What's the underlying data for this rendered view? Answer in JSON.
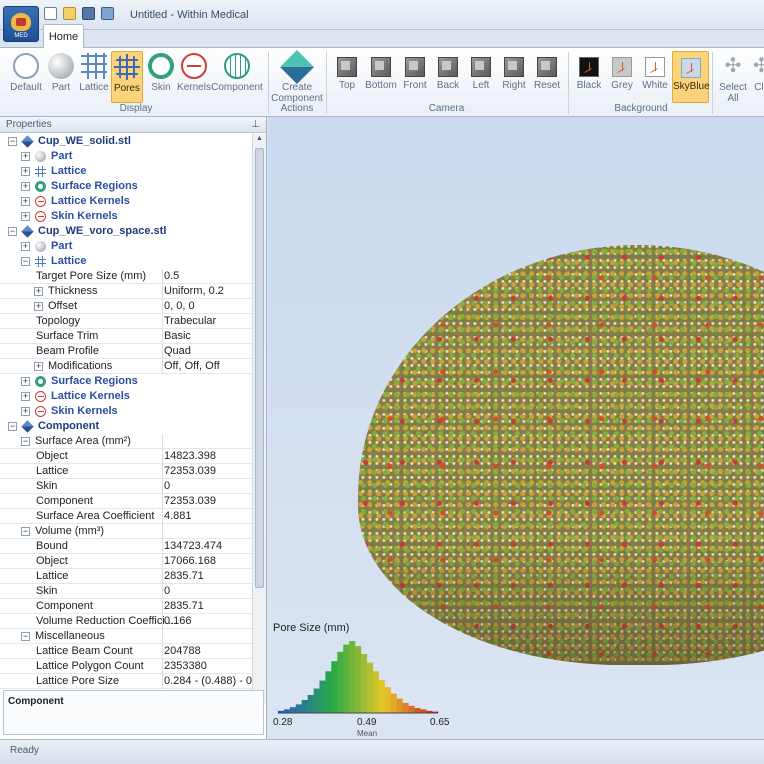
{
  "window": {
    "title": "Untitled - Within Medical",
    "app_logo_text": "MED"
  },
  "tabs": [
    {
      "label": "Home"
    }
  ],
  "ribbon": {
    "display": {
      "label": "Display",
      "buttons": [
        {
          "label": "Default",
          "icon": "default-icon"
        },
        {
          "label": "Part",
          "icon": "part-icon"
        },
        {
          "label": "Lattice",
          "icon": "lattice-icon"
        },
        {
          "label": "Pores",
          "icon": "pores-icon",
          "active": true
        },
        {
          "label": "Skin",
          "icon": "skin-icon"
        },
        {
          "label": "Kernels",
          "icon": "kernels-icon"
        },
        {
          "label": "Component",
          "icon": "component-icon"
        }
      ]
    },
    "actions": {
      "label": "Actions",
      "buttons": [
        {
          "label": "Create\nComponent",
          "icon": "create-component-icon"
        }
      ]
    },
    "camera": {
      "label": "Camera",
      "buttons": [
        {
          "label": "Top"
        },
        {
          "label": "Bottom"
        },
        {
          "label": "Front"
        },
        {
          "label": "Back"
        },
        {
          "label": "Left"
        },
        {
          "label": "Right"
        },
        {
          "label": "Reset"
        }
      ]
    },
    "background": {
      "label": "Background",
      "buttons": [
        {
          "label": "Black"
        },
        {
          "label": "Grey"
        },
        {
          "label": "White"
        },
        {
          "label": "SkyBlue",
          "active": true
        }
      ]
    },
    "select_all": {
      "label": "Select\nAll"
    },
    "cut_off_label": "Cl"
  },
  "properties": {
    "header": "Properties",
    "tree": [
      {
        "type": "file",
        "label": "Cup_WE_solid.stl",
        "depth": 0,
        "expand": "-"
      },
      {
        "type": "node",
        "label": "Part",
        "icon": "part",
        "depth": 1,
        "expand": "+"
      },
      {
        "type": "node",
        "label": "Lattice",
        "icon": "lattice",
        "depth": 1,
        "expand": "+"
      },
      {
        "type": "node",
        "label": "Surface Regions",
        "icon": "skin",
        "depth": 1,
        "expand": "+"
      },
      {
        "type": "node",
        "label": "Lattice Kernels",
        "icon": "kern",
        "depth": 1,
        "expand": "+"
      },
      {
        "type": "node",
        "label": "Skin Kernels",
        "icon": "kern",
        "depth": 1,
        "expand": "+"
      },
      {
        "type": "file",
        "label": "Cup_WE_voro_space.stl",
        "depth": 0,
        "expand": "-"
      },
      {
        "type": "node",
        "label": "Part",
        "icon": "part",
        "depth": 1,
        "expand": "+"
      },
      {
        "type": "node",
        "label": "Lattice",
        "icon": "lattice",
        "depth": 1,
        "expand": "-"
      },
      {
        "type": "prop",
        "label": "Target Pore Size (mm)",
        "value": "0.5",
        "depth": 2
      },
      {
        "type": "prop",
        "label": "Thickness",
        "value": "Uniform, 0.2",
        "depth": 2,
        "expand": "+"
      },
      {
        "type": "prop",
        "label": "Offset",
        "value": "0, 0, 0",
        "depth": 2,
        "expand": "+"
      },
      {
        "type": "prop",
        "label": "Topology",
        "value": "Trabecular",
        "depth": 2
      },
      {
        "type": "prop",
        "label": "Surface Trim",
        "value": "Basic",
        "depth": 2
      },
      {
        "type": "prop",
        "label": "Beam Profile",
        "value": "Quad",
        "depth": 2
      },
      {
        "type": "prop",
        "label": "Modifications",
        "value": "Off, Off, Off",
        "depth": 2,
        "expand": "+"
      },
      {
        "type": "node",
        "label": "Surface Regions",
        "icon": "skin",
        "depth": 1,
        "expand": "+"
      },
      {
        "type": "node",
        "label": "Lattice Kernels",
        "icon": "kern",
        "depth": 1,
        "expand": "+"
      },
      {
        "type": "node",
        "label": "Skin Kernels",
        "icon": "kern",
        "depth": 1,
        "expand": "+"
      },
      {
        "type": "file",
        "label": "Component",
        "depth": 0,
        "expand": "-"
      },
      {
        "type": "prop",
        "label": "Surface Area (mm²)",
        "value": "",
        "depth": 1,
        "expand": "-"
      },
      {
        "type": "prop",
        "label": "Object",
        "value": "14823.398",
        "depth": 2
      },
      {
        "type": "prop",
        "label": "Lattice",
        "value": "72353.039",
        "depth": 2
      },
      {
        "type": "prop",
        "label": "Skin",
        "value": "0",
        "depth": 2
      },
      {
        "type": "prop",
        "label": "Component",
        "value": "72353.039",
        "depth": 2
      },
      {
        "type": "prop",
        "label": "Surface Area Coefficient",
        "value": "4.881",
        "depth": 2
      },
      {
        "type": "prop",
        "label": "Volume (mm³)",
        "value": "",
        "depth": 1,
        "expand": "-"
      },
      {
        "type": "prop",
        "label": "Bound",
        "value": "134723.474",
        "depth": 2
      },
      {
        "type": "prop",
        "label": "Object",
        "value": "17066.168",
        "depth": 2
      },
      {
        "type": "prop",
        "label": "Lattice",
        "value": "2835.71",
        "depth": 2
      },
      {
        "type": "prop",
        "label": "Skin",
        "value": "0",
        "depth": 2
      },
      {
        "type": "prop",
        "label": "Component",
        "value": "2835.71",
        "depth": 2
      },
      {
        "type": "prop",
        "label": "Volume Reduction Coeffici...",
        "value": "0.166",
        "depth": 2
      },
      {
        "type": "prop",
        "label": "Miscellaneous",
        "value": "",
        "depth": 1,
        "expand": "-"
      },
      {
        "type": "prop",
        "label": "Lattice Beam Count",
        "value": "204788",
        "depth": 2
      },
      {
        "type": "prop",
        "label": "Lattice Polygon Count",
        "value": "2353380",
        "depth": 2
      },
      {
        "type": "prop",
        "label": "Lattice Pore Size",
        "value": "0.284 - (0.488) - 0....",
        "depth": 2
      }
    ],
    "description_title": "Component"
  },
  "viewport": {
    "legend": {
      "title": "Pore Size (mm)",
      "min": "0.28",
      "mid": "0.49",
      "max": "0.65",
      "mid_caption": "Mean",
      "histogram": [
        0.03,
        0.05,
        0.08,
        0.12,
        0.18,
        0.25,
        0.34,
        0.45,
        0.58,
        0.72,
        0.85,
        0.95,
        1.0,
        0.93,
        0.82,
        0.7,
        0.58,
        0.46,
        0.36,
        0.27,
        0.2,
        0.14,
        0.1,
        0.07,
        0.05,
        0.03,
        0.02
      ]
    }
  },
  "status": {
    "text": "Ready"
  }
}
